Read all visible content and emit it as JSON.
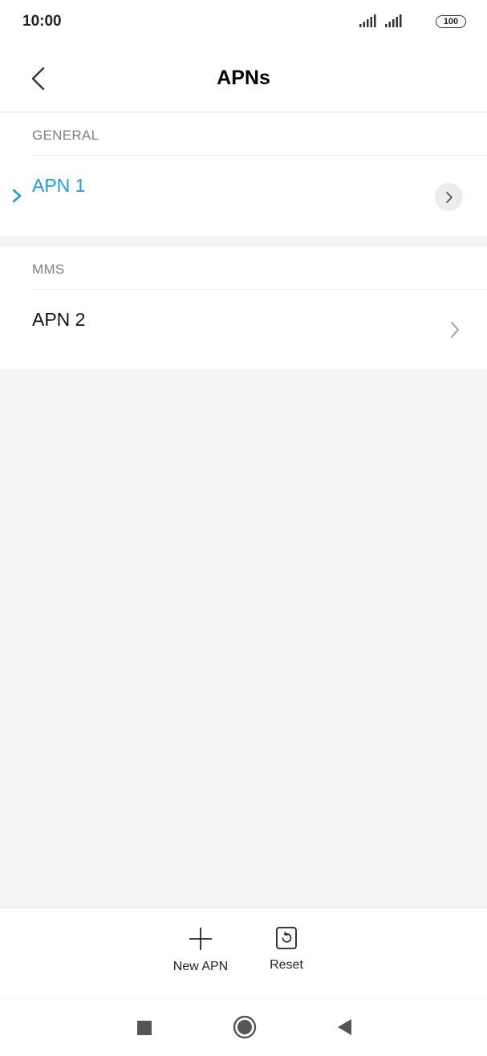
{
  "status_bar": {
    "time": "10:00",
    "battery": "100"
  },
  "header": {
    "title": "APNs"
  },
  "sections": [
    {
      "header": "GENERAL",
      "items": [
        {
          "name": "APN 1",
          "selected": true
        }
      ]
    },
    {
      "header": "MMS",
      "items": [
        {
          "name": "APN 2",
          "selected": false
        }
      ]
    }
  ],
  "actions": {
    "new_apn": "New APN",
    "reset": "Reset"
  },
  "colors": {
    "accent": "#1a9de0",
    "background": "#f5f5f5"
  }
}
